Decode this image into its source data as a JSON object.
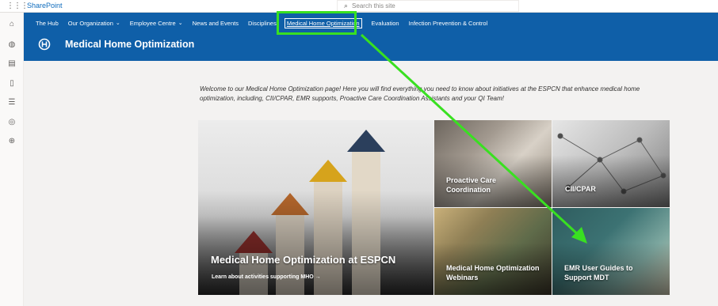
{
  "suite": {
    "app_name": "SharePoint",
    "search_placeholder": "Search this site"
  },
  "nav": [
    {
      "label": "The Hub",
      "has_chevron": false
    },
    {
      "label": "Our Organization",
      "has_chevron": true
    },
    {
      "label": "Employee Centre",
      "has_chevron": true
    },
    {
      "label": "News and Events",
      "has_chevron": false
    },
    {
      "label": "Disciplines",
      "has_chevron": false
    },
    {
      "label": "Medical Home Optimization",
      "has_chevron": false,
      "current": true
    },
    {
      "label": "Evaluation",
      "has_chevron": false
    },
    {
      "label": "Infection Prevention & Control",
      "has_chevron": false
    }
  ],
  "site": {
    "title": "Medical Home Optimization"
  },
  "intro": "Welcome to our Medical Home Optimization page! Here you will find everything you need to know about initiatives at the ESPCN that enhance medical home optimization, including, CII/CPAR, EMR supports, Proactive Care Coordination Assistants and your QI Team!",
  "tiles": {
    "hero": {
      "title": "Medical Home Optimization at ESPCN",
      "link": "Learn about activities supporting MHO →"
    },
    "proactive": {
      "title": "Proactive Care Coordination"
    },
    "cii": {
      "title": "CII/CPAR"
    },
    "webinars": {
      "title": "Medical Home Optimization Webinars"
    },
    "emr": {
      "title": "EMR User Guides to Support MDT"
    }
  },
  "colors": {
    "header": "#0f5fa8",
    "highlight": "#39e021"
  },
  "icons": {
    "rail": [
      "home-icon",
      "globe-icon",
      "news-icon",
      "document-icon",
      "list-icon",
      "chat-icon",
      "add-icon"
    ]
  }
}
